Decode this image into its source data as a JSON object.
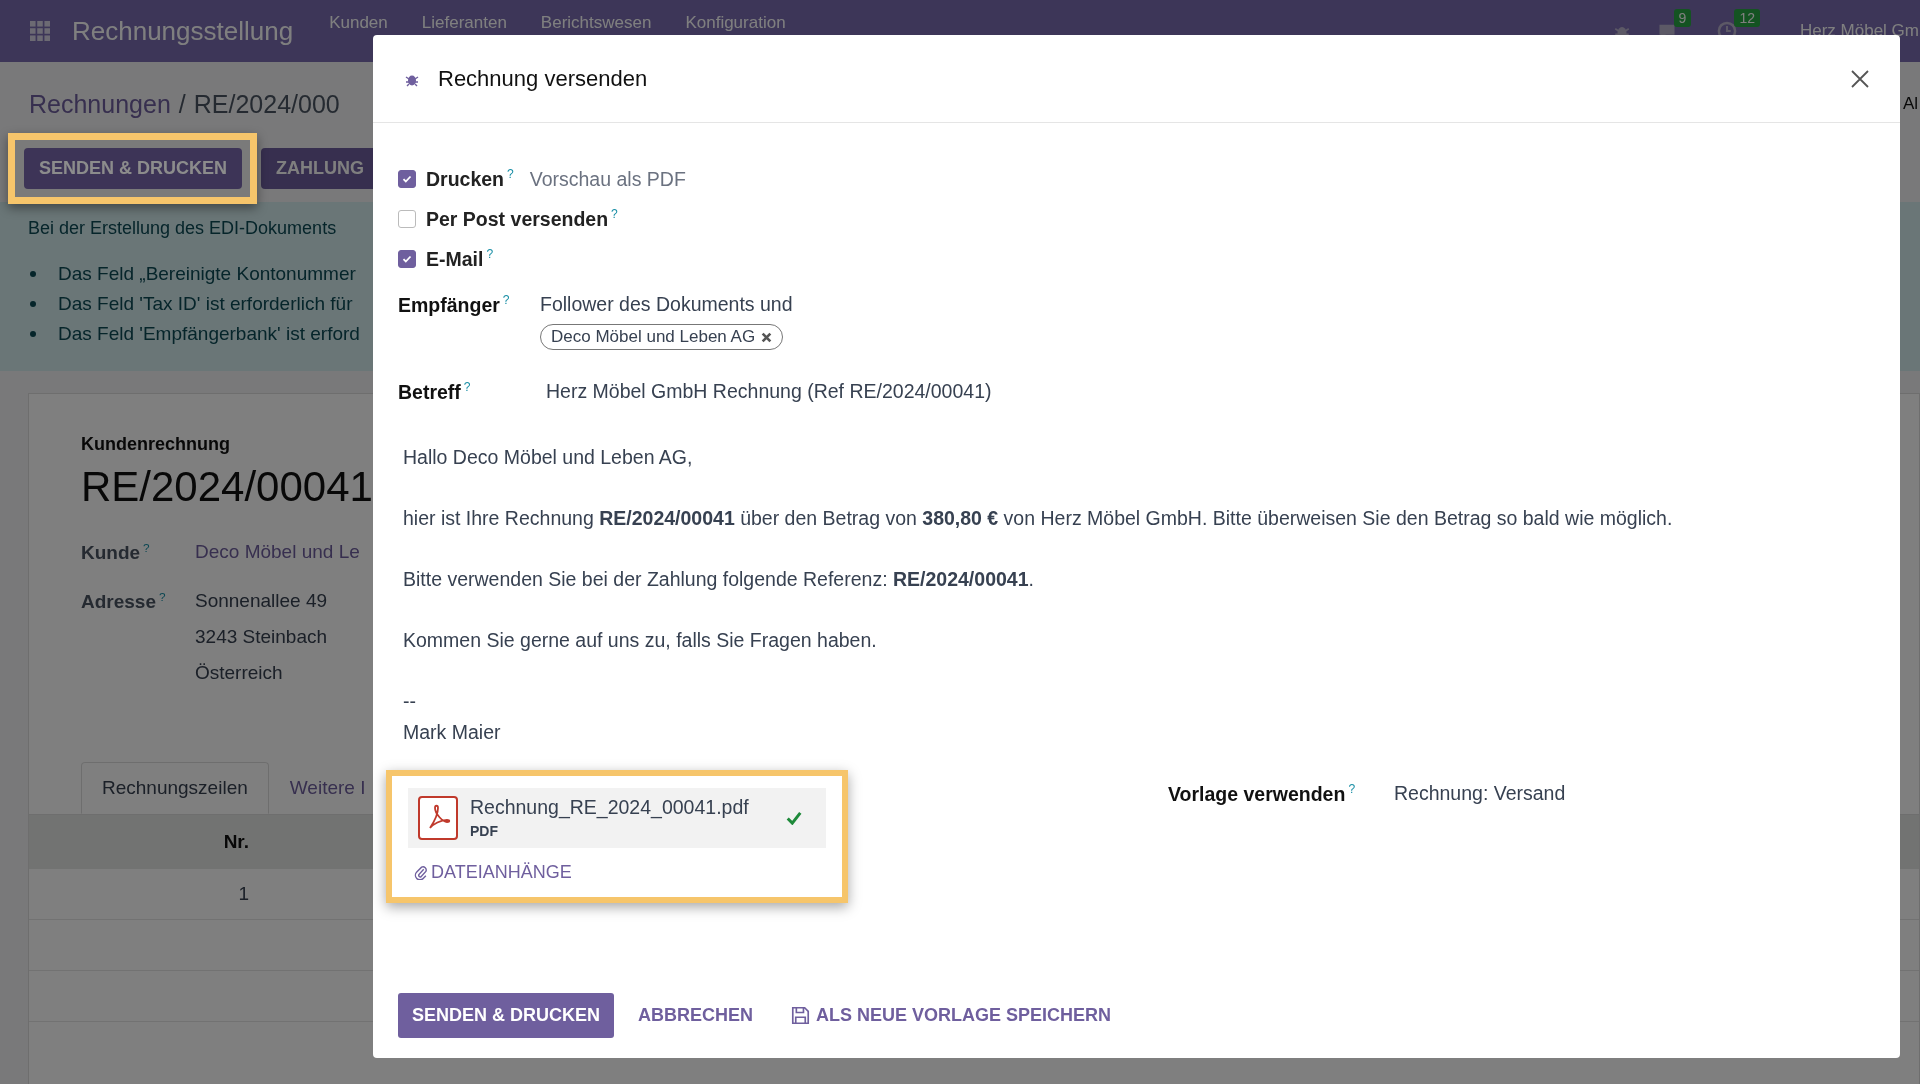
{
  "navbar": {
    "app_title": "Rechnungsstellung",
    "menu": [
      "Kunden",
      "Lieferanten",
      "Berichtswesen",
      "Konfiguration"
    ],
    "messages_count": "9",
    "activities_count": "12",
    "company": "Herz Möbel Gm"
  },
  "breadcrumb": {
    "items": [
      "Rechnungen",
      "RE/2024/000"
    ],
    "separator": "/"
  },
  "actions": [
    {
      "label": "SENDEN & DRUCKEN",
      "highlighted": true
    },
    {
      "label": "ZAHLUNG",
      "highlighted": false
    }
  ],
  "right_edge_text": "Al",
  "alert": {
    "text": "Bei der Erstellung des EDI-Dokuments",
    "items": [
      "Das Feld „Bereinigte Kontonummer",
      "Das Feld 'Tax ID' ist erforderlich für",
      "Das Feld 'Empfängerbank' ist erford"
    ]
  },
  "record": {
    "type_label": "Kundenrechnung",
    "name": "RE/2024/00041",
    "customer": {
      "label": "Kunde$^{?}$",
      "value": "Deco Möbel und Le"
    },
    "address": {
      "label": "Adresse$^{?}$",
      "lines": [
        "Sonnenallee 49",
        "3243 Steinbach",
        "Österreich"
      ]
    },
    "tabs": [
      {
        "label": "Rechnungszeilen",
        "selected": true
      },
      {
        "label": "Weitere I",
        "selected": false
      }
    ],
    "table": {
      "columns": [
        "Nr."
      ],
      "rows": [
        [
          "1"
        ]
      ]
    }
  },
  "dialog": {
    "title": "Rechnung versenden",
    "options": [
      {
        "label": "Drucken$^{?}$",
        "checked": true,
        "hint": "Vorschau als PDF"
      },
      {
        "label": "Per Post versenden$^{?}$",
        "checked": false
      },
      {
        "label": "E-Mail$^{?}$",
        "checked": true
      }
    ],
    "recipients": {
      "label": "Empfänger$^{?}$",
      "text": "Follower des Dokuments und",
      "tags": [
        "Deco Möbel und Leben AG"
      ]
    },
    "subject": {
      "label": "Betreff$^{?}$",
      "value": "Herz Möbel GmbH Rechnung (Ref RE/2024/00041)"
    },
    "body": [
      "Hallo Deco Möbel und Leben AG,",
      "hier ist Ihre Rechnung **RE/2024/00041** über den Betrag von **380,80 €** von Herz Möbel GmbH. Bitte überweisen Sie den Betrag so bald wie möglich.",
      "Bitte verwenden Sie bei der Zahlung folgende Referenz: **RE/2024/00041**.",
      "Kommen Sie gerne auf uns zu, falls Sie Fragen haben."
    ],
    "signature": [
      "--",
      "Mark Maier"
    ],
    "attachments": {
      "highlighted": true,
      "files": [
        {
          "name": "Rechnung_RE_2024_00041.pdf",
          "type": "PDF",
          "uploaded": true
        }
      ],
      "button": "DATEIANHÄNGE"
    },
    "template": {
      "label": "Vorlage verwenden$^{?}$",
      "value": "Rechnung: Versand"
    },
    "buttons": [
      {
        "label": "SENDEN & DRUCKEN",
        "kind": "primary"
      },
      {
        "label": "ABBRECHEN",
        "kind": "link"
      },
      {
        "label": "ALS NEUE VORLAGE SPEICHERN",
        "kind": "save"
      }
    ]
  }
}
